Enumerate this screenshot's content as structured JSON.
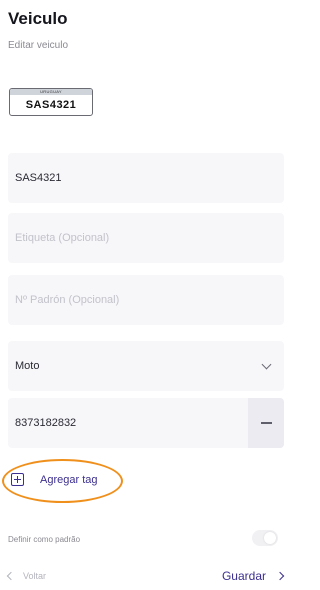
{
  "header": {
    "title": "Veiculo",
    "subtitle": "Editar veiculo"
  },
  "plate": {
    "country": "URUGUAY",
    "number": "SAS4321"
  },
  "form": {
    "plate_value": "SAS4321",
    "label_placeholder": "Etiqueta (Opcional)",
    "padron_placeholder": "Nº Padrón (Opcional)",
    "vehicle_type": "Moto",
    "tag_value": "8373182832",
    "add_tag_label": "Agregar tag",
    "default_label": "Definir como padrão",
    "default_enabled": false
  },
  "footer": {
    "back_label": "Voltar",
    "save_label": "Guardar"
  },
  "colors": {
    "accent": "#3b2f8f",
    "highlight": "#f0901c",
    "field_bg": "#f7f7fa"
  }
}
